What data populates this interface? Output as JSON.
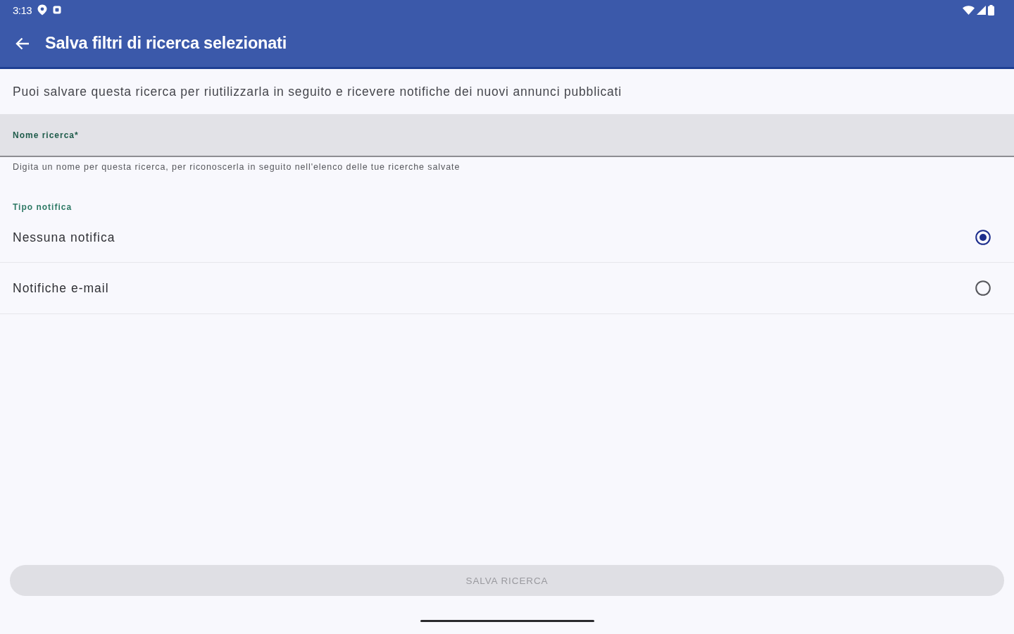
{
  "status_bar": {
    "time": "3:13"
  },
  "app_bar": {
    "title": "Salva filtri di ricerca selezionati"
  },
  "intro": "Puoi salvare questa ricerca per riutilizzarla in seguito e ricevere notifiche dei nuovi annunci pubblicati",
  "name_field": {
    "label": "Nome ricerca*",
    "helper": "Digita un nome per questa ricerca, per riconoscerla in seguito nell'elenco delle tue ricerche salvate"
  },
  "notification_type": {
    "label": "Tipo notifica",
    "options": [
      {
        "label": "Nessuna notifica",
        "selected": true
      },
      {
        "label": "Notifiche e-mail",
        "selected": false
      }
    ]
  },
  "save_button": {
    "label": "SALVA RICERCA",
    "disabled": true
  }
}
